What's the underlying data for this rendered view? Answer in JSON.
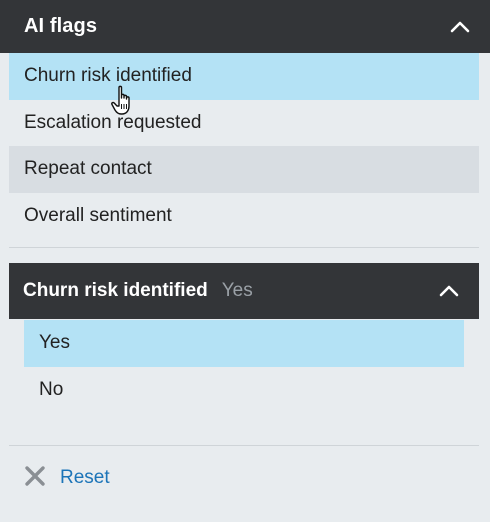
{
  "header": {
    "title": "AI flags",
    "collapse_icon": "chevron-up-icon"
  },
  "flags": [
    {
      "label": "Churn risk identified",
      "state": "selected"
    },
    {
      "label": "Escalation requested",
      "state": "normal"
    },
    {
      "label": "Repeat contact",
      "state": "hover"
    },
    {
      "label": "Overall sentiment",
      "state": "normal"
    }
  ],
  "detail": {
    "title": "Churn risk identified",
    "current_value": "Yes",
    "collapse_icon": "chevron-up-icon",
    "options": [
      {
        "label": "Yes",
        "selected": true
      },
      {
        "label": "No",
        "selected": false
      }
    ]
  },
  "reset": {
    "label": "Reset",
    "icon": "close-icon"
  },
  "colors": {
    "header_bg": "#333538",
    "selected_bg": "#b4e2f5",
    "hover_bg": "#d8dde2",
    "panel_bg": "#e8ecef",
    "link": "#1b74b8"
  }
}
